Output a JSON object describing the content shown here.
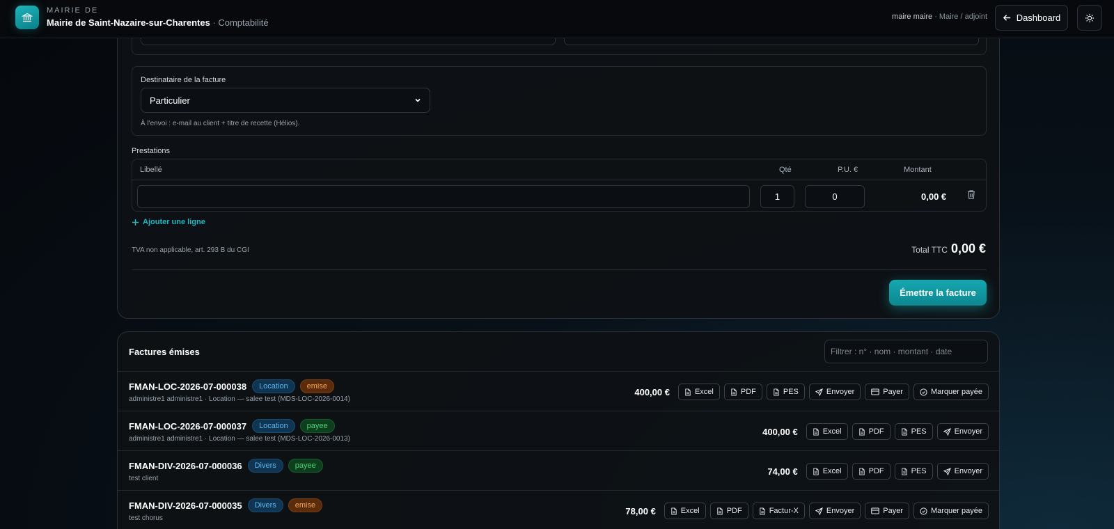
{
  "header": {
    "kicker": "MAIRIE DE",
    "org_name": "Mairie de Saint-Nazaire-sur-Charentes",
    "section": "· Comptabilité",
    "user": "maire maire",
    "role": "· Maire / adjoint",
    "dashboard_label": "Dashboard"
  },
  "form": {
    "recipient_label": "Destinataire de la facture",
    "recipient_value": "Particulier",
    "recipient_hint": "À l'envoi : e-mail au client + titre de recette (Hélios).",
    "prestations_label": "Prestations",
    "columns": {
      "libelle": "Libellé",
      "qte": "Qté",
      "pu": "P.U. €",
      "montant": "Montant"
    },
    "line": {
      "libelle": "",
      "qte": "1",
      "pu": "0",
      "montant": "0,00 €"
    },
    "add_line": "Ajouter une ligne",
    "tva_note": "TVA non applicable, art. 293 B du CGI",
    "total_label": "Total TTC",
    "total_value": "0,00 €",
    "submit_label": "Émettre la facture"
  },
  "invoices": {
    "title": "Factures émises",
    "filter_placeholder": "Filtrer : n° · nom · montant · date",
    "rows": [
      {
        "ref": "FMAN-LOC-2026-07-000038",
        "type": "Location",
        "status": "emise",
        "sub": "administre1 administre1 · Location — salee test (MDS-LOC-2026-0014)",
        "amount": "400,00 €",
        "actions": [
          "Excel",
          "PDF",
          "PES",
          "Envoyer",
          "Payer",
          "Marquer payée"
        ]
      },
      {
        "ref": "FMAN-LOC-2026-07-000037",
        "type": "Location",
        "status": "payee",
        "sub": "administre1 administre1 · Location — salee test (MDS-LOC-2026-0013)",
        "amount": "400,00 €",
        "actions": [
          "Excel",
          "PDF",
          "PES",
          "Envoyer"
        ]
      },
      {
        "ref": "FMAN-DIV-2026-07-000036",
        "type": "Divers",
        "status": "payee",
        "sub": "test client",
        "amount": "74,00 €",
        "actions": [
          "Excel",
          "PDF",
          "PES",
          "Envoyer"
        ]
      },
      {
        "ref": "FMAN-DIV-2026-07-000035",
        "type": "Divers",
        "status": "emise",
        "sub": "test chorus",
        "amount": "78,00 €",
        "actions": [
          "Excel",
          "PDF",
          "Factur-X",
          "Envoyer",
          "Payer",
          "Marquer payée"
        ]
      }
    ]
  },
  "icons": [
    "bank-icon",
    "arrow-left-icon",
    "sun-icon",
    "chevron-down-icon",
    "trash-icon",
    "plus-icon",
    "file-icon",
    "send-icon",
    "card-icon",
    "check-circle-icon"
  ],
  "colors": {
    "accent": "#16a7b0",
    "badge_blue": "#5bb6f0",
    "badge_orange": "#f5a457",
    "badge_green": "#4fd27a"
  }
}
